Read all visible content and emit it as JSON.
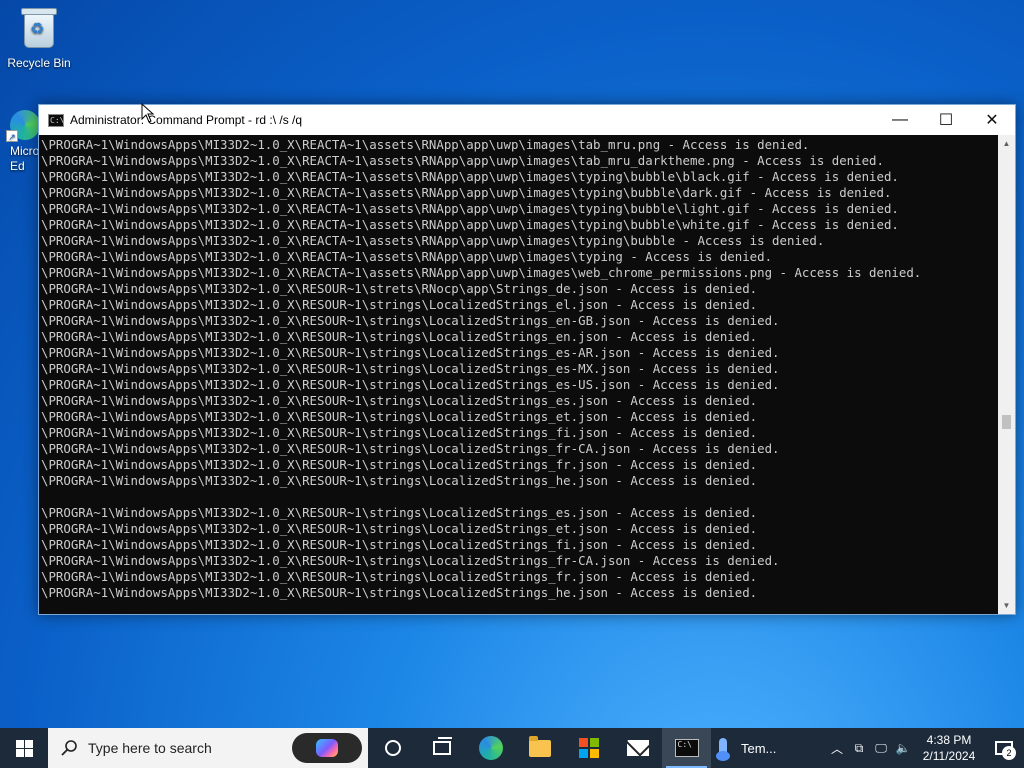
{
  "desktop": {
    "icons": [
      {
        "label": "Recycle Bin"
      },
      {
        "label": "Micro\nEd"
      }
    ]
  },
  "window": {
    "title": "Administrator: Command Prompt - rd  :\\ /s /q",
    "controls": {
      "minimize": "—",
      "maximize": "☐",
      "close": "✕"
    }
  },
  "console": {
    "lines": [
      "\\PROGRA~1\\WindowsApps\\MI33D2~1.0_X\\REACTA~1\\assets\\RNApp\\app\\uwp\\images\\tab_mru.png - Access is denied.",
      "\\PROGRA~1\\WindowsApps\\MI33D2~1.0_X\\REACTA~1\\assets\\RNApp\\app\\uwp\\images\\tab_mru_darktheme.png - Access is denied.",
      "\\PROGRA~1\\WindowsApps\\MI33D2~1.0_X\\REACTA~1\\assets\\RNApp\\app\\uwp\\images\\typing\\bubble\\black.gif - Access is denied.",
      "\\PROGRA~1\\WindowsApps\\MI33D2~1.0_X\\REACTA~1\\assets\\RNApp\\app\\uwp\\images\\typing\\bubble\\dark.gif - Access is denied.",
      "\\PROGRA~1\\WindowsApps\\MI33D2~1.0_X\\REACTA~1\\assets\\RNApp\\app\\uwp\\images\\typing\\bubble\\light.gif - Access is denied.",
      "\\PROGRA~1\\WindowsApps\\MI33D2~1.0_X\\REACTA~1\\assets\\RNApp\\app\\uwp\\images\\typing\\bubble\\white.gif - Access is denied.",
      "\\PROGRA~1\\WindowsApps\\MI33D2~1.0_X\\REACTA~1\\assets\\RNApp\\app\\uwp\\images\\typing\\bubble - Access is denied.",
      "\\PROGRA~1\\WindowsApps\\MI33D2~1.0_X\\REACTA~1\\assets\\RNApp\\app\\uwp\\images\\typing - Access is denied.",
      "\\PROGRA~1\\WindowsApps\\MI33D2~1.0_X\\REACTA~1\\assets\\RNApp\\app\\uwp\\images\\web_chrome_permissions.png - Access is denied.",
      "\\PROGRA~1\\WindowsApps\\MI33D2~1.0_X\\RESOUR~1\\strets\\RNocp\\app\\Strings_de.json - Access is denied.",
      "\\PROGRA~1\\WindowsApps\\MI33D2~1.0_X\\RESOUR~1\\strings\\LocalizedStrings_el.json - Access is denied.",
      "\\PROGRA~1\\WindowsApps\\MI33D2~1.0_X\\RESOUR~1\\strings\\LocalizedStrings_en-GB.json - Access is denied.",
      "\\PROGRA~1\\WindowsApps\\MI33D2~1.0_X\\RESOUR~1\\strings\\LocalizedStrings_en.json - Access is denied.",
      "\\PROGRA~1\\WindowsApps\\MI33D2~1.0_X\\RESOUR~1\\strings\\LocalizedStrings_es-AR.json - Access is denied.",
      "\\PROGRA~1\\WindowsApps\\MI33D2~1.0_X\\RESOUR~1\\strings\\LocalizedStrings_es-MX.json - Access is denied.",
      "\\PROGRA~1\\WindowsApps\\MI33D2~1.0_X\\RESOUR~1\\strings\\LocalizedStrings_es-US.json - Access is denied.",
      "\\PROGRA~1\\WindowsApps\\MI33D2~1.0_X\\RESOUR~1\\strings\\LocalizedStrings_es.json - Access is denied.",
      "\\PROGRA~1\\WindowsApps\\MI33D2~1.0_X\\RESOUR~1\\strings\\LocalizedStrings_et.json - Access is denied.",
      "\\PROGRA~1\\WindowsApps\\MI33D2~1.0_X\\RESOUR~1\\strings\\LocalizedStrings_fi.json - Access is denied.",
      "\\PROGRA~1\\WindowsApps\\MI33D2~1.0_X\\RESOUR~1\\strings\\LocalizedStrings_fr-CA.json - Access is denied.",
      "\\PROGRA~1\\WindowsApps\\MI33D2~1.0_X\\RESOUR~1\\strings\\LocalizedStrings_fr.json - Access is denied.",
      "\\PROGRA~1\\WindowsApps\\MI33D2~1.0_X\\RESOUR~1\\strings\\LocalizedStrings_he.json - Access is denied.",
      "",
      "\\PROGRA~1\\WindowsApps\\MI33D2~1.0_X\\RESOUR~1\\strings\\LocalizedStrings_es.json - Access is denied.",
      "\\PROGRA~1\\WindowsApps\\MI33D2~1.0_X\\RESOUR~1\\strings\\LocalizedStrings_et.json - Access is denied.",
      "\\PROGRA~1\\WindowsApps\\MI33D2~1.0_X\\RESOUR~1\\strings\\LocalizedStrings_fi.json - Access is denied.",
      "\\PROGRA~1\\WindowsApps\\MI33D2~1.0_X\\RESOUR~1\\strings\\LocalizedStrings_fr-CA.json - Access is denied.",
      "\\PROGRA~1\\WindowsApps\\MI33D2~1.0_X\\RESOUR~1\\strings\\LocalizedStrings_fr.json - Access is denied.",
      "\\PROGRA~1\\WindowsApps\\MI33D2~1.0_X\\RESOUR~1\\strings\\LocalizedStrings_he.json - Access is denied."
    ]
  },
  "taskbar": {
    "search_placeholder": "Type here to search",
    "weather_label": "Tem...",
    "clock_time": "4:38 PM",
    "clock_date": "2/11/2024",
    "notification_count": "2",
    "apps": [
      {
        "name": "cortana",
        "icon": "cortana-icon"
      },
      {
        "name": "task-view",
        "icon": "task-view-icon"
      },
      {
        "name": "edge",
        "icon": "edge-icon"
      },
      {
        "name": "file-explorer",
        "icon": "folder-icon"
      },
      {
        "name": "store",
        "icon": "store-icon"
      },
      {
        "name": "mail",
        "icon": "mail-icon"
      },
      {
        "name": "command-prompt",
        "icon": "cmd-icon",
        "active": true
      }
    ]
  },
  "colors": {
    "console_bg": "#0c0c0c",
    "console_fg": "#cccccc",
    "taskbar_bg": "#1c2a3a",
    "desktop_accent": "#0a5fc7"
  }
}
